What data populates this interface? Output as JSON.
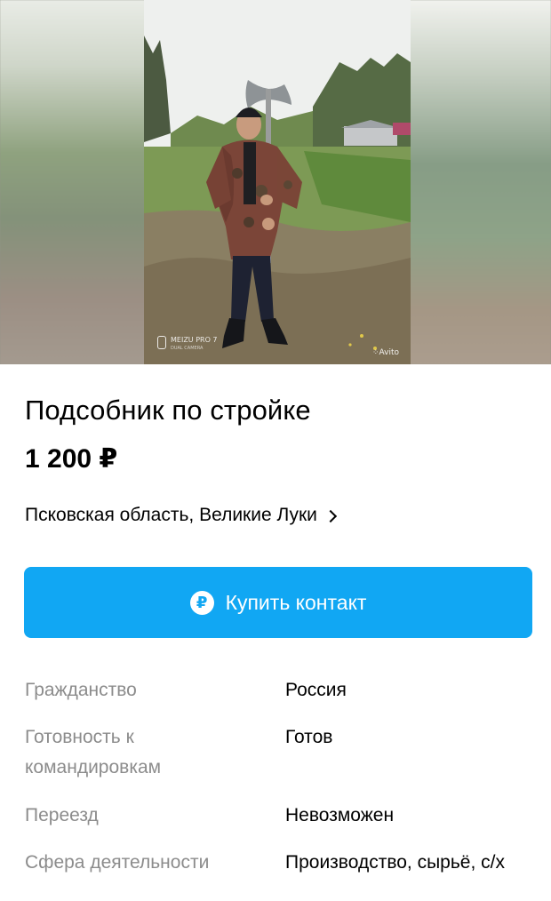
{
  "gallery": {
    "device_watermark": "MEIZU PRO 7",
    "device_watermark_sub": "DUAL CAMERA",
    "site_watermark": "Avito"
  },
  "listing": {
    "title": "Подсобник по стройке",
    "price": "1 200 ₽",
    "location": "Псковская область, Великие Луки"
  },
  "buy_button": {
    "icon_glyph": "₽",
    "label": "Купить контакт",
    "color": "#11a7f3"
  },
  "params": [
    {
      "key": "Гражданство",
      "value": "Россия"
    },
    {
      "key": "Готовность к командировкам",
      "value": "Готов"
    },
    {
      "key": "Переезд",
      "value": "Невозможен"
    },
    {
      "key": "Сфера деятельности",
      "value": "Производство, сырьё, с/х"
    }
  ],
  "icons": {
    "location_chevron": "chevron-right-icon",
    "button_icon": "ruble-circle-icon"
  }
}
